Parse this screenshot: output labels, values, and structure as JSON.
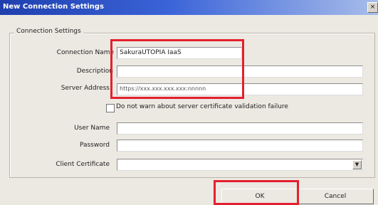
{
  "window": {
    "title": "New Connection Settings",
    "close_glyph": "×"
  },
  "group": {
    "label": "Connection Settings"
  },
  "fields": {
    "connection_name": {
      "label": "Connection Name",
      "value": "SakuraUTOPIA IaaS"
    },
    "description": {
      "label": "Description",
      "value": ""
    },
    "server_address": {
      "label": "Server Address",
      "value": "https://xxx.xxx.xxx.xxx:nnnnn"
    },
    "user_name": {
      "label": "User Name",
      "value": ""
    },
    "password": {
      "label": "Password",
      "value": ""
    },
    "client_certificate": {
      "label": "Client Certificate",
      "value": ""
    }
  },
  "checkbox": {
    "label": "Do not warn about server certificate validation failure",
    "checked": false
  },
  "buttons": {
    "ok": "OK",
    "cancel": "Cancel"
  },
  "highlight_color": "#e4202e"
}
